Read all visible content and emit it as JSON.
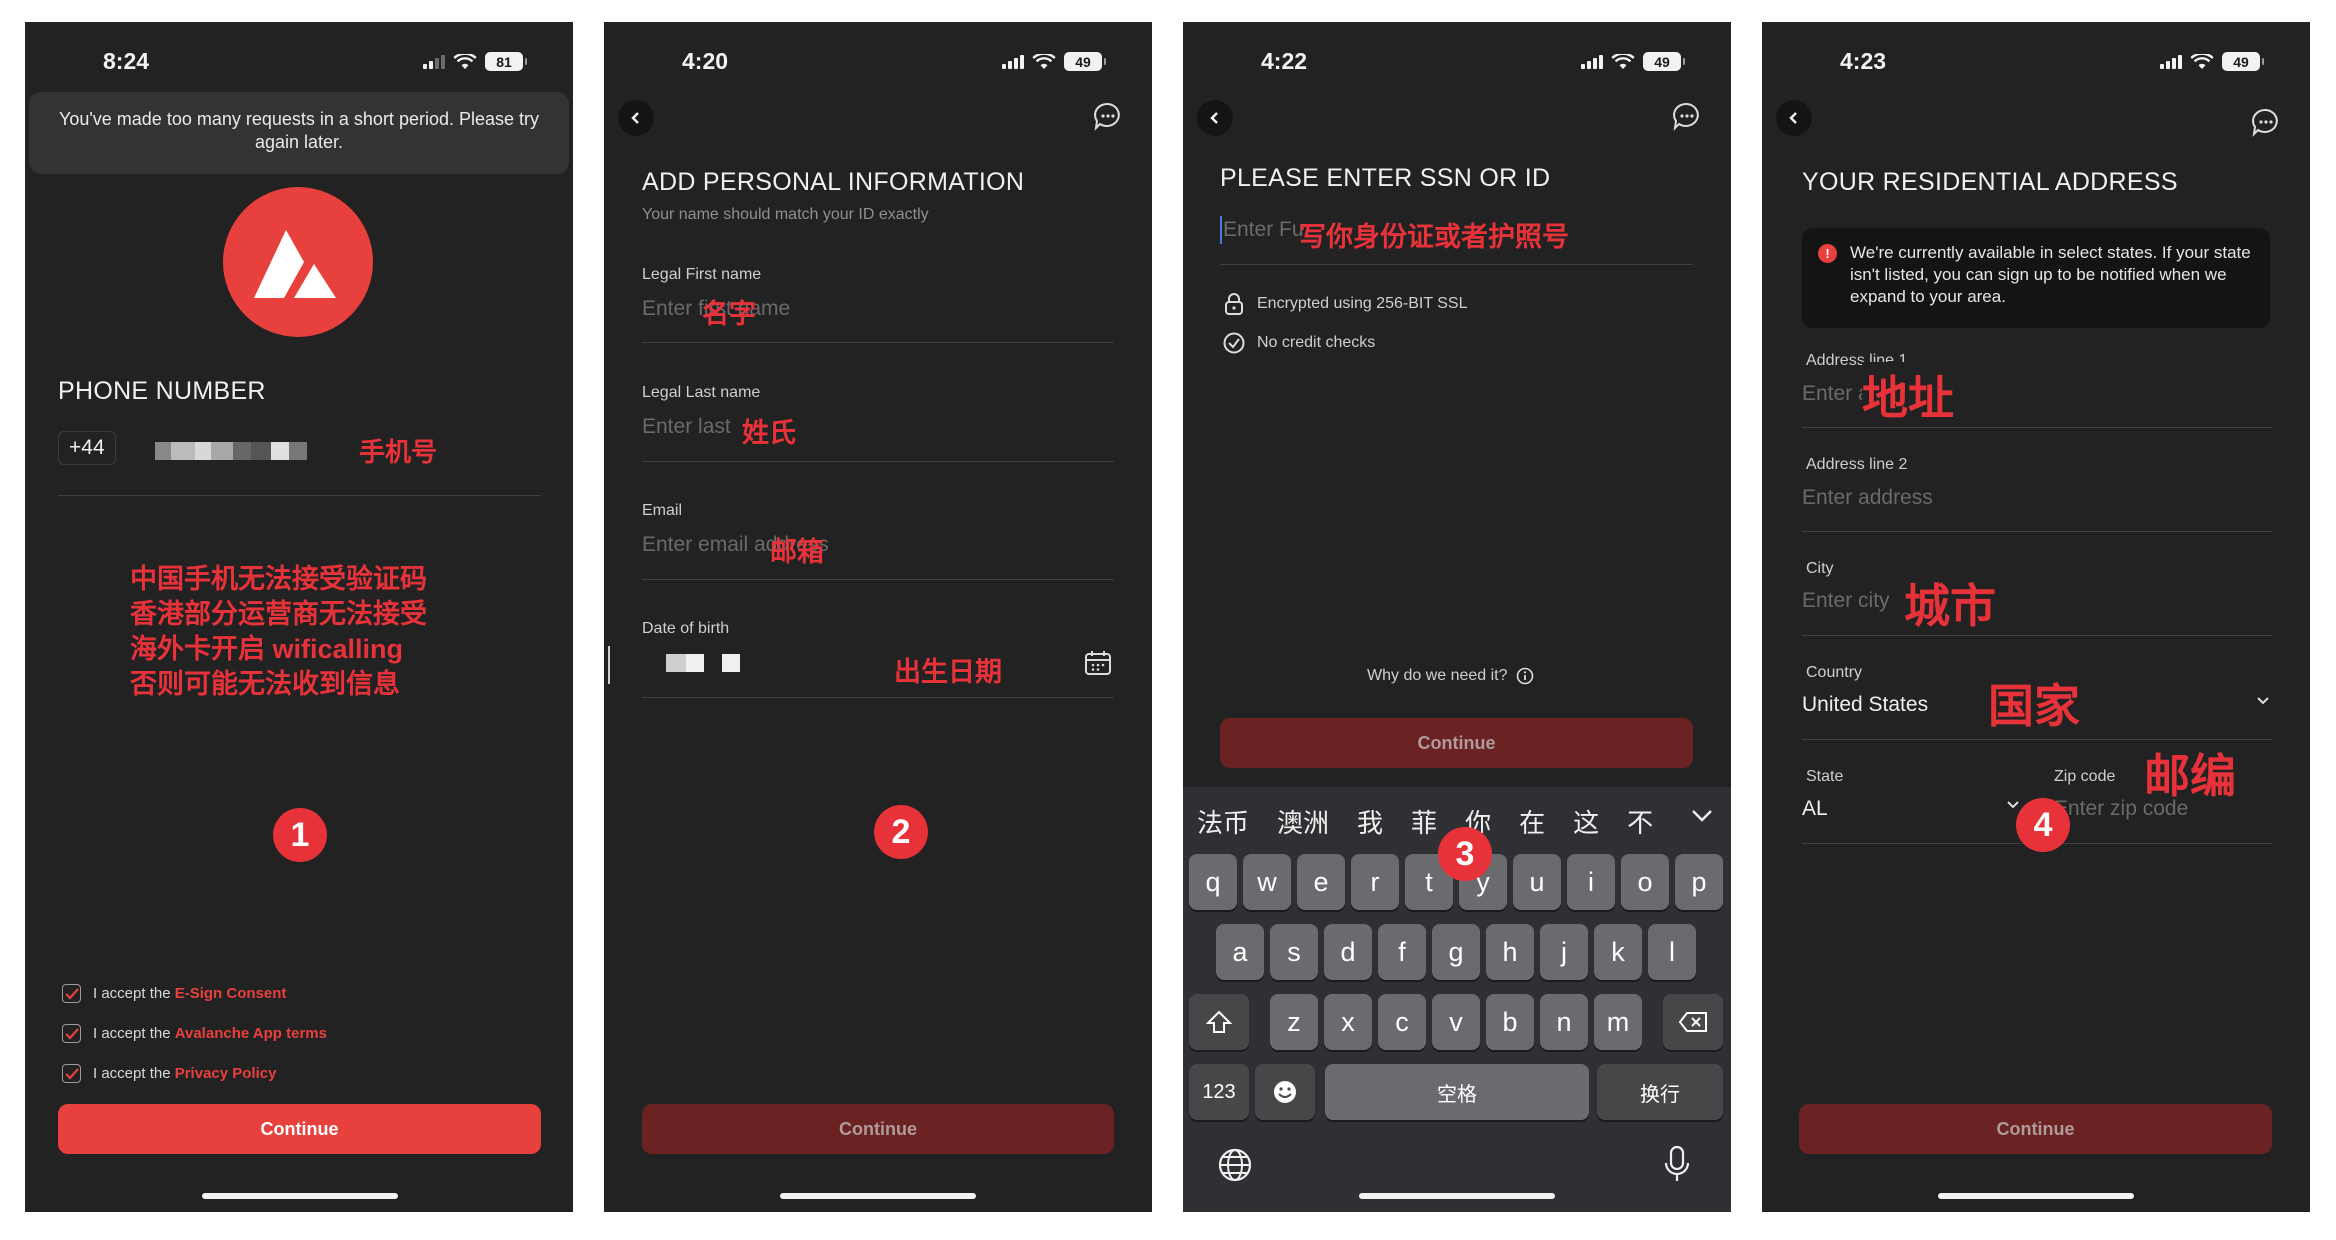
{
  "panel1": {
    "time": "8:24",
    "battery": "81",
    "toast": "You've made too many requests in a short period. Please try again later.",
    "title": "PHONE NUMBER",
    "country_code": "+44",
    "phone_annotation": "手机号",
    "note_lines": [
      "中国手机无法接受验证码",
      "香港部分运营商无法接受",
      "海外卡开启 wificalling",
      "否则可能无法收到信息"
    ],
    "step": "1",
    "checkboxes": [
      {
        "prefix": "I accept the ",
        "link": "E-Sign Consent"
      },
      {
        "prefix": "I accept the ",
        "link": "Avalanche App terms"
      },
      {
        "prefix": "I accept the ",
        "link": "Privacy Policy"
      }
    ],
    "continue": "Continue"
  },
  "panel2": {
    "time": "4:20",
    "battery": "49",
    "title": "ADD PERSONAL INFORMATION",
    "subtitle": "Your name should match your ID exactly",
    "first_name_label": "Legal First name",
    "first_name_placeholder": "Enter first name",
    "first_name_annotation": "名字",
    "last_name_label": "Legal Last name",
    "last_name_placeholder": "Enter last",
    "last_name_annotation": "姓氏",
    "email_label": "Email",
    "email_placeholder": "Enter email address",
    "email_annotation": "邮箱",
    "dob_label": "Date of birth",
    "dob_annotation": "出生日期",
    "step": "2",
    "continue": "Continue"
  },
  "panel3": {
    "time": "4:22",
    "battery": "49",
    "title": "PLEASE ENTER SSN OR ID",
    "ssn_placeholder": "Enter Fu",
    "ssn_annotation": "写你身份证或者护照号",
    "encrypted": "Encrypted using 256-BIT SSL",
    "no_credit": "No credit checks",
    "why": "Why do we need it?",
    "continue": "Continue",
    "step": "3",
    "candidates": [
      "法币",
      "澳洲",
      "我",
      "菲",
      "你",
      "在",
      "这",
      "不"
    ],
    "keyboard": {
      "row1": [
        "q",
        "w",
        "e",
        "r",
        "t",
        "y",
        "u",
        "i",
        "o",
        "p"
      ],
      "row2": [
        "a",
        "s",
        "d",
        "f",
        "g",
        "h",
        "j",
        "k",
        "l"
      ],
      "row3": [
        "z",
        "x",
        "c",
        "v",
        "b",
        "n",
        "m"
      ],
      "numbers": "123",
      "space": "空格",
      "return": "换行"
    }
  },
  "panel4": {
    "time": "4:23",
    "battery": "49",
    "title": "YOUR RESIDENTIAL ADDRESS",
    "alert": "We're currently available in select states. If your state isn't listed, you can sign up to be notified when we expand to your area.",
    "addr1_label": "Address line 1",
    "addr1_placeholder": "Enter address",
    "addr1_annotation": "地址",
    "addr2_label": "Address line 2",
    "addr2_placeholder": "Enter address",
    "city_label": "City",
    "city_placeholder": "Enter city",
    "city_annotation": "城市",
    "country_label": "Country",
    "country_value": "United States",
    "country_annotation": "国家",
    "state_label": "State",
    "state_value": "AL",
    "zip_label": "Zip code",
    "zip_placeholder": "Enter zip code",
    "zip_annotation": "邮编",
    "step": "4",
    "continue": "Continue"
  },
  "colors": {
    "accent": "#e8403d",
    "annotation": "#e8323a",
    "screen_bg": "#222223",
    "disabled_button": "#6a2222"
  },
  "icons": [
    "back-chevron-icon",
    "chat-bubble-icon",
    "calendar-icon",
    "lock-icon",
    "check-circle-icon",
    "info-icon",
    "alert-icon",
    "chevron-down-icon",
    "globe-icon",
    "microphone-icon",
    "emoji-icon",
    "shift-icon",
    "delete-icon",
    "checkbox-icon",
    "avalanche-logo"
  ]
}
